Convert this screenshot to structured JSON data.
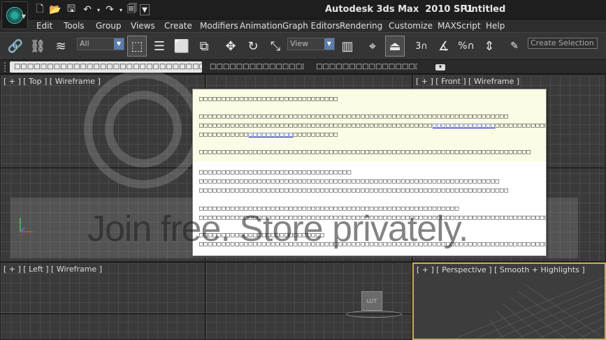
{
  "window": {
    "app_title": "Autodesk 3ds Max  2010 SP1",
    "document_title": "Untitled"
  },
  "quick_access": [
    {
      "icon": "new-file-icon"
    },
    {
      "icon": "open-folder-icon"
    },
    {
      "icon": "save-icon"
    },
    {
      "icon": "undo-icon"
    },
    {
      "icon": "redo-icon"
    },
    {
      "icon": "project-folder-icon"
    }
  ],
  "menu": [
    "Edit",
    "Tools",
    "Group",
    "Views",
    "Create",
    "Modifiers",
    "Animation",
    "Graph Editors",
    "Rendering",
    "Customize",
    "MAXScript",
    "Help"
  ],
  "toolbar": {
    "selection_filter": "All",
    "reference_coordinate": "View",
    "named_selection_placeholder": "Create Selection Se",
    "snap_angle_label": "3",
    "percent_label": "%"
  },
  "ribbon": {
    "tabs": [
      "□□□□□□□□□□□□□□□□□□□□□□□□□□□□□□□□□",
      "□□□□□□□□□□□□□□□□□□",
      "□□□□□□□□□□□□□□□□□□□□"
    ],
    "collapse_glyph": "▾"
  },
  "viewports": {
    "top": {
      "label": "[ + ] [ Top ] [ Wireframe ]"
    },
    "front": {
      "label": "[ + ] [ Front ] [ Wireframe ]"
    },
    "left": {
      "label": "[ + ] [ Left ] [ Wireframe ]"
    },
    "perspective": {
      "label": "[ + ] [ Perspective ] [ Smooth + Highlights ]"
    }
  },
  "dialog": {
    "heading": "□□□□□□□□□□□□□□□□□□□□□□□□□□□□□□□",
    "para1_line1": "□□□□□□□□□□□□□□□□□□□□□□□□□□□□□□□□□□□□□□□□□□□□□□□□□□□□□□□□□□□□□□□□□□□□□",
    "para1_line2_pre": "□□□□□□□□□□□□□□□□□□□□□□□□□□□□□□□□□□□□□□□□□□□□□□□□□□□□",
    "para1_line2_link": "□□□□□□□□□□□□□□",
    "para1_line2_post": "□□□□□□□□□□□□",
    "para1_line3_pre": "□□□□□□□□□□□",
    "para1_line3_link": "□□□□□□□□□□",
    "para1_line3_post": "□□□□□□□□□□",
    "para2": "□□□□□□□□□□□□□□□□□□□□□□□□□□□□□□□□□□□□□□□□□□□□□□□□□□□□□□□□□□□□□□□□□□□□□□□□□□",
    "section2_title": "□□□□□□□□□□□□□□□□□□□□□□□□□□□□□□□□□□",
    "section2_line1": "□□□□□□□□□□□□□□□□□□□□□□□□□□□□□□□□□□□□□□□□□□□□□□□□□□□□□□□□□□□□□□□□□□□",
    "section2_line2": "□□□□□□□□□□□□□□□□□□□□□□□□□□□□□□□□□□□□□□□□□□□□□□□□□□□□□□□□□□□□□□□□□□□□□",
    "section3_title": "□□□□□□□□□□□□□□□□□□□□□□□□□□□□□□□□□□□□□□□□□□□□□□□□□□□□□□□□□□",
    "section3_line1": "□□□□□□□□□□□□□□□□□□□□□□□□□□□□□□□□□□□□□□□□□□□□□□□□□□□□□□□□□□□□□□□□□□□□□□□□□□□□□□□",
    "section4_title": "□□□□□□□□□□□□□□□□□□□□□□□□□□□□",
    "section4_line1": "□□□□□□□□□□□□□□□□□□□□□□□□□□□□□□□□□□□□□□□□□□□□□□□□□□□□□□□□□□□□□□□□□□□□□□□□□□□□□□□□"
  },
  "watermark": {
    "text": "Join free. Store privately."
  },
  "scene": {
    "object_label": "LUT"
  },
  "colors": {
    "active_viewport_border": "#c9b24a",
    "dialog_highlight_bg": "#fbfbe6",
    "link": "#2b3fc4"
  }
}
